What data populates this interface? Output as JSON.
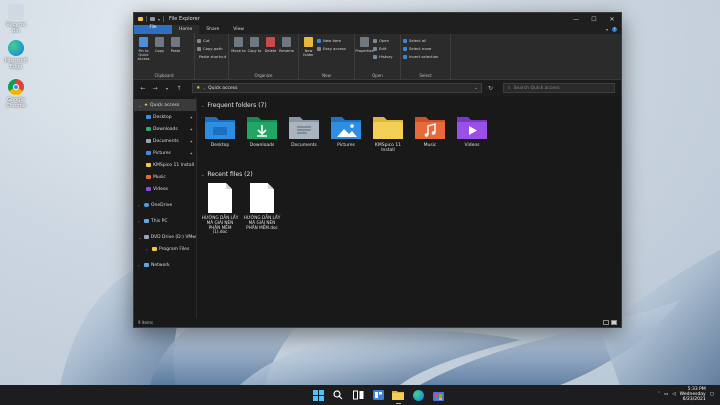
{
  "desktop": {
    "icons": [
      {
        "label": "Recycle Bin",
        "color": "#cfd8e3"
      },
      {
        "label": "Microsoft Edge",
        "color": "#1fa0c9"
      },
      {
        "label": "Google Chrome",
        "color": "#e6b02b"
      }
    ]
  },
  "window": {
    "title": "File Explorer",
    "controls": {
      "minimize": "—",
      "maximize": "☐",
      "close": "✕"
    }
  },
  "ribbon": {
    "tabs": [
      "File",
      "Home",
      "Share",
      "View"
    ],
    "help": "?",
    "groups": {
      "clipboard": {
        "label": "Clipboard",
        "pin": "Pin to Quick access",
        "copy": "Copy",
        "paste": "Paste",
        "cut": "Cut",
        "copy_path": "Copy path",
        "paste_shortcut": "Paste shortcut"
      },
      "organize": {
        "label": "Organize",
        "move_to": "Move to",
        "copy_to": "Copy to",
        "delete": "Delete",
        "rename": "Rename"
      },
      "new": {
        "label": "New",
        "new_folder": "New folder",
        "new_item": "New item",
        "easy_access": "Easy access"
      },
      "open": {
        "label": "Open",
        "properties": "Properties",
        "open": "Open",
        "edit": "Edit",
        "history": "History"
      },
      "select": {
        "label": "Select",
        "select_all": "Select all",
        "select_none": "Select none",
        "invert": "Invert selection"
      }
    }
  },
  "address": {
    "path": "Quick access",
    "search_placeholder": "Search Quick access"
  },
  "nav": {
    "quick_access": "Quick access",
    "pinned": [
      {
        "label": "Desktop",
        "color": "#3b8fe0",
        "pinned": true
      },
      {
        "label": "Downloads",
        "color": "#2fa86a",
        "pinned": true
      },
      {
        "label": "Documents",
        "color": "#9aa4ae",
        "pinned": true
      },
      {
        "label": "Pictures",
        "color": "#3f8fe0",
        "pinned": true
      },
      {
        "label": "KMSpico 11 Install",
        "color": "#f3c54b",
        "pinned": false
      },
      {
        "label": "Music",
        "color": "#e06c3a",
        "pinned": false
      },
      {
        "label": "Videos",
        "color": "#8a4be0",
        "pinned": false
      }
    ],
    "onedrive": "OneDrive",
    "this_pc": "This PC",
    "dvd": "DVD Drive (D:) VMw",
    "program_files": "Program Files",
    "network": "Network",
    "pin_glyph": "📌"
  },
  "main": {
    "frequent_title": "Frequent folders (7)",
    "folders": [
      {
        "label": "Desktop",
        "color": "#2d8de0",
        "accent": "#1b6fc0"
      },
      {
        "label": "Downloads",
        "color": "#22a565",
        "accent": "#168a52"
      },
      {
        "label": "Documents",
        "color": "#aab4bf",
        "accent": "#8a96a3"
      },
      {
        "label": "Pictures",
        "color": "#2f8ee2",
        "accent": "#1d72c4"
      },
      {
        "label": "KMSpico 11 Install",
        "color": "#f5cf55",
        "accent": "#e0b33a"
      },
      {
        "label": "Music",
        "color": "#e86a3c",
        "accent": "#c8522a"
      },
      {
        "label": "Videos",
        "color": "#9a4fe6",
        "accent": "#7a36c6"
      }
    ],
    "recent_title": "Recent files (2)",
    "files": [
      {
        "label": "HƯỚNG DẪN LẤY MÃ GIẢI NÉN PHẦN MỀM (1).doc"
      },
      {
        "label": "HƯỚNG DẪN LẤY MÃ GIẢI NÉN PHẦN MỀM.doc"
      }
    ]
  },
  "status": {
    "items": "9 items"
  },
  "taskbar": {
    "time": "5:33 PM",
    "day": "Wednesday",
    "date": "6/23/2021"
  }
}
